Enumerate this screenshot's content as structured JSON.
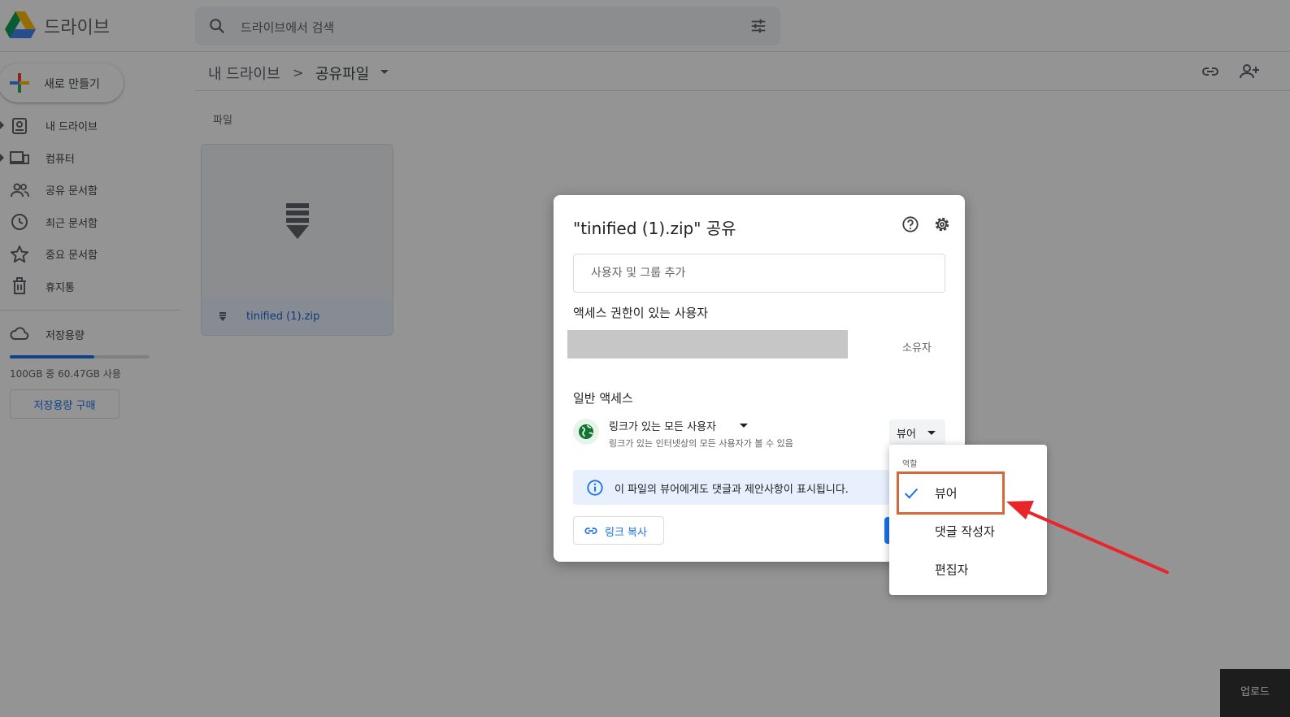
{
  "app": {
    "title": "드라이브"
  },
  "search": {
    "placeholder": "드라이브에서 검색"
  },
  "sidebar": {
    "new_label": "새로 만들기",
    "items": [
      {
        "label": "내 드라이브",
        "icon": "my-drive-icon"
      },
      {
        "label": "컴퓨터",
        "icon": "computers-icon"
      },
      {
        "label": "공유 문서함",
        "icon": "shared-icon"
      },
      {
        "label": "최근 문서함",
        "icon": "clock-icon"
      },
      {
        "label": "중요 문서함",
        "icon": "star-icon"
      },
      {
        "label": "휴지통",
        "icon": "trash-icon"
      }
    ],
    "storage": {
      "label": "저장용량",
      "usage_text": "100GB 중 60.47GB 사용",
      "used_fraction": 0.6047,
      "buy_label": "저장용량 구매"
    }
  },
  "breadcrumb": {
    "root": "내 드라이브",
    "separator": ">",
    "current": "공유파일"
  },
  "files": {
    "section_label": "파일",
    "items": [
      {
        "name": "tinified (1).zip"
      }
    ]
  },
  "share_dialog": {
    "title": "\"tinified (1).zip\" 공유",
    "add_placeholder": "사용자 및 그룹 추가",
    "access_title": "액세스 권한이 있는 사용자",
    "owner_label": "소유자",
    "general_title": "일반 액세스",
    "link_access": "링크가 있는 모든 사용자",
    "link_access_desc": "링크가 있는 인터넷상의 모든 사용자가 볼 수 있음",
    "role_current": "뷰어",
    "info_text": "이 파일의 뷰어에게도 댓글과 제안사항이 표시됩니다.",
    "copy_link_label": "링크 복사"
  },
  "role_menu": {
    "header": "역할",
    "items": [
      {
        "label": "뷰어",
        "checked": true
      },
      {
        "label": "댓글 작성자",
        "checked": false
      },
      {
        "label": "편집자",
        "checked": false
      }
    ]
  },
  "upload_chip": {
    "label": "업로드"
  },
  "colors": {
    "accent": "#1a73e8",
    "highlight": "#d4683a",
    "arrow": "#e8262a"
  }
}
